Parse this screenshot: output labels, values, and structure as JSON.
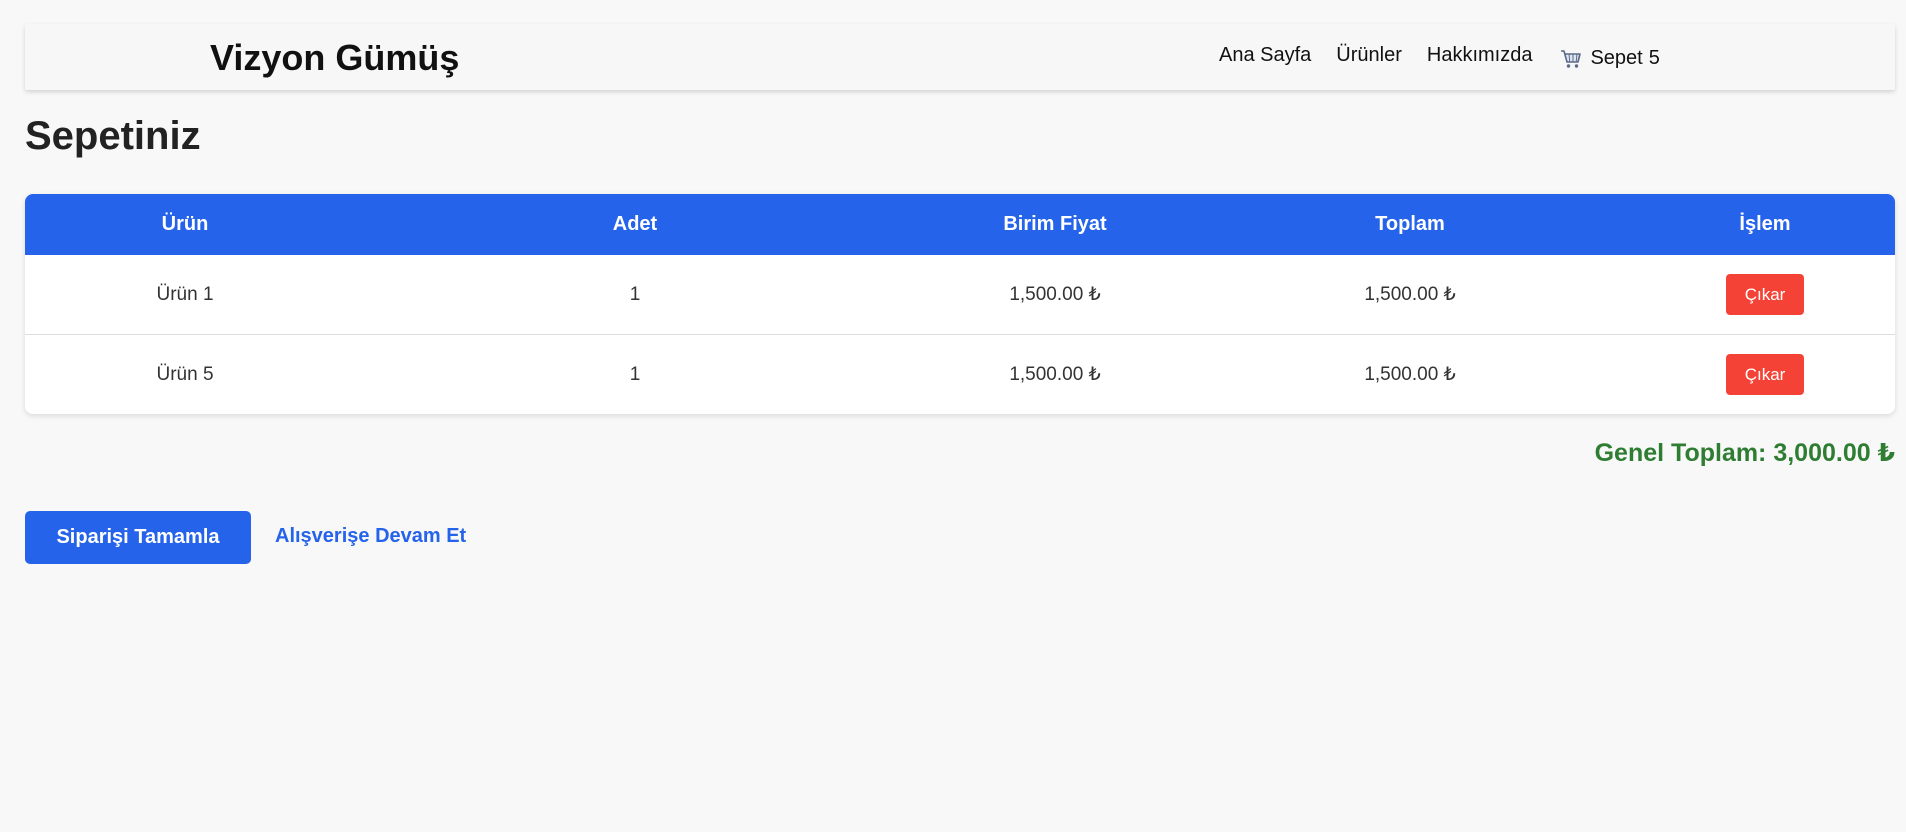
{
  "header": {
    "brand": "Vizyon Gümüş",
    "nav": {
      "home": "Ana Sayfa",
      "products": "Ürünler",
      "about": "Hakkımızda",
      "cart_label": "Sepet",
      "cart_count": "5",
      "cart_icon": "shopping-cart-icon"
    }
  },
  "page": {
    "title": "Sepetiniz"
  },
  "cart": {
    "columns": [
      "Ürün",
      "Adet",
      "Birim Fiyat",
      "Toplam",
      "İşlem"
    ],
    "rows": [
      {
        "product": "Ürün 1",
        "qty": "1",
        "unit_price": "1,500.00 ₺",
        "total": "1,500.00 ₺",
        "action": "Çıkar"
      },
      {
        "product": "Ürün 5",
        "qty": "1",
        "unit_price": "1,500.00 ₺",
        "total": "1,500.00 ₺",
        "action": "Çıkar"
      }
    ],
    "grand_total": "Genel Toplam: 3,000.00 ₺"
  },
  "actions": {
    "checkout": "Siparişi Tamamla",
    "continue_shopping": "Alışverişe Devam Et"
  },
  "colors": {
    "primary": "#2563eb",
    "danger": "#f44336",
    "success": "#2e7d32",
    "background": "#f8f8f8"
  }
}
